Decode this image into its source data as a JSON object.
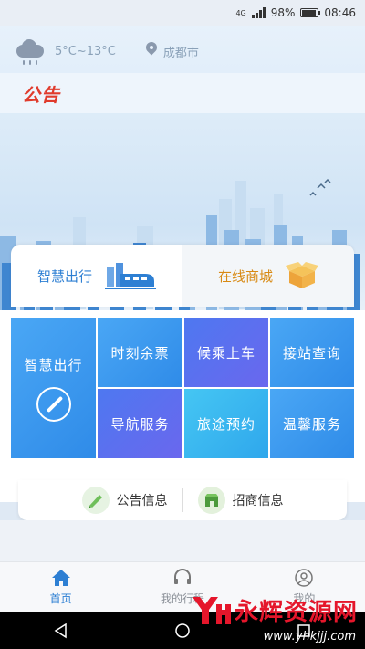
{
  "status": {
    "network": "4G",
    "battery": "98%",
    "time": "08:46"
  },
  "weather": {
    "temperature": "5°C~13°C",
    "city": "成都市",
    "icon": "rain-cloud-icon"
  },
  "notice": {
    "logo": "公告"
  },
  "tabs": [
    {
      "label": "智慧出行",
      "icon": "train-icon",
      "active": true
    },
    {
      "label": "在线商城",
      "icon": "box-icon",
      "active": false
    }
  ],
  "grid": {
    "main": {
      "label": "智慧出行",
      "icon": "compass-icon"
    },
    "items": [
      {
        "label": "时刻余票"
      },
      {
        "label": "候乘上车"
      },
      {
        "label": "接站查询"
      },
      {
        "label": "导航服务"
      },
      {
        "label": "旅途预约"
      },
      {
        "label": "温馨服务"
      }
    ]
  },
  "info": [
    {
      "label": "公告信息",
      "icon": "announcement-icon"
    },
    {
      "label": "招商信息",
      "icon": "merchant-icon"
    }
  ],
  "nav": [
    {
      "label": "首页",
      "icon": "home-icon",
      "active": true
    },
    {
      "label": "我的行程",
      "icon": "headset-icon",
      "active": false
    },
    {
      "label": "我的",
      "icon": "user-icon",
      "active": false
    }
  ],
  "watermark": {
    "text": "永辉资源网",
    "url": "www.yhkjjj.com",
    "logo": "yh-logo"
  }
}
